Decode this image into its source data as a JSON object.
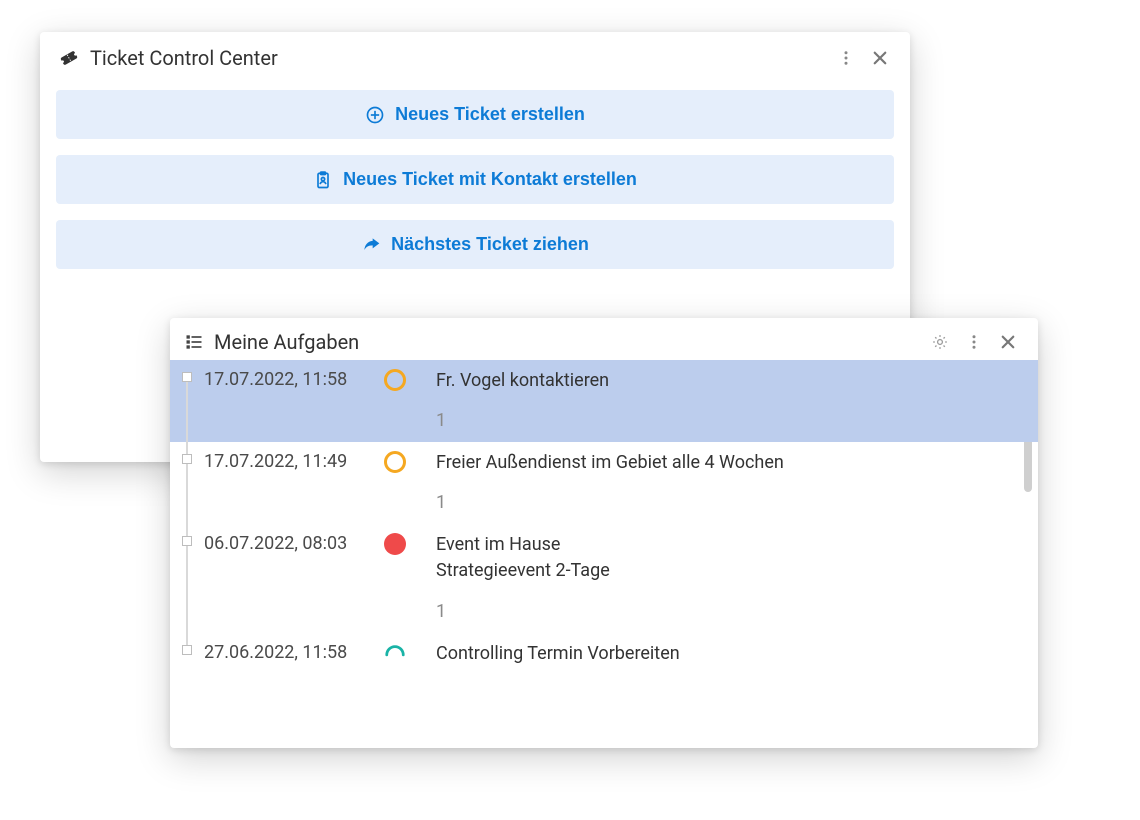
{
  "ticket_panel": {
    "title": "Ticket Control Center",
    "buttons": [
      {
        "icon": "plus-circle-icon",
        "label": "Neues Ticket erstellen"
      },
      {
        "icon": "clipboard-person-icon",
        "label": "Neues Ticket mit Kontakt erstellen"
      },
      {
        "icon": "share-arrow-icon",
        "label": "Nächstes Ticket ziehen"
      }
    ]
  },
  "tasks_panel": {
    "title": "Meine Aufgaben",
    "items": [
      {
        "date": "17.07.2022, 11:58",
        "status": {
          "kind": "ring",
          "color": "orange"
        },
        "title": "Fr. Vogel kontaktieren",
        "line2": "",
        "sub": "1",
        "selected": true
      },
      {
        "date": "17.07.2022, 11:49",
        "status": {
          "kind": "ring",
          "color": "orange"
        },
        "title": "Freier Außendienst im Gebiet alle 4 Wochen",
        "line2": "",
        "sub": "1",
        "selected": false
      },
      {
        "date": "06.07.2022, 08:03",
        "status": {
          "kind": "dot",
          "color": "red"
        },
        "title": "Event im Hause",
        "line2": "Strategieevent 2-Tage",
        "sub": "1",
        "selected": false
      },
      {
        "date": "27.06.2022, 11:58",
        "status": {
          "kind": "arc",
          "color": "teal"
        },
        "title": "Controlling Termin Vorbereiten",
        "line2": "",
        "sub": "",
        "selected": false
      }
    ]
  },
  "colors": {
    "action_bg": "#e5eefb",
    "action_fg": "#0d7bd6",
    "selection_bg": "#bccded",
    "status_orange": "#f5a821",
    "status_red": "#ef4a4a",
    "status_teal": "#19b3a6"
  }
}
